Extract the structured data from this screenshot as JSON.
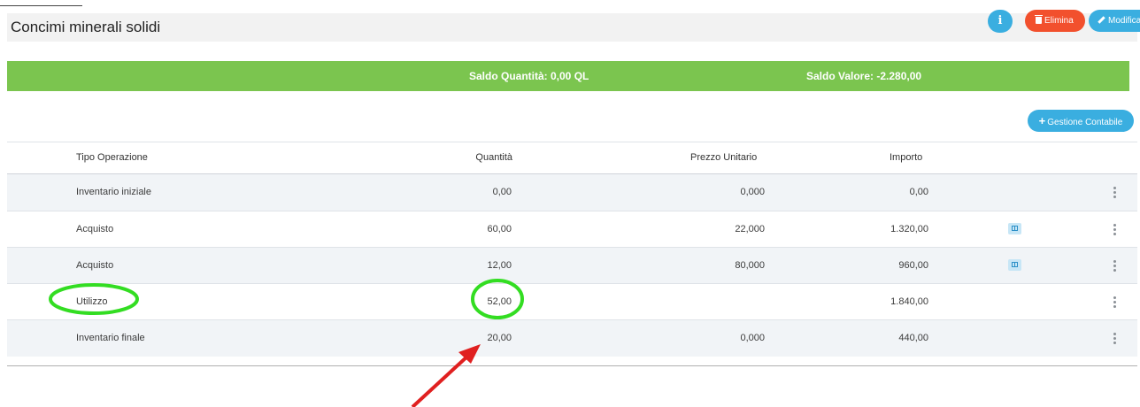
{
  "header": {
    "title": "Concimi minerali solidi",
    "info_label": "i",
    "delete_label": "Elimina",
    "edit_label": "Modifica"
  },
  "saldo": {
    "quantita": "Saldo Quantità: 0,00 QL",
    "valore": "Saldo Valore: -2.280,00"
  },
  "gestione_label": "Gestione Contabile",
  "table": {
    "headers": {
      "tipo": "Tipo Operazione",
      "quantita": "Quantità",
      "prezzo": "Prezzo Unitario",
      "importo": "Importo"
    },
    "rows": [
      {
        "tipo": "Inventario iniziale",
        "quantita": "0,00",
        "prezzo": "0,000",
        "importo": "0,00",
        "doc": false
      },
      {
        "tipo": "Acquisto",
        "quantita": "60,00",
        "prezzo": "22,000",
        "importo": "1.320,00",
        "doc": true
      },
      {
        "tipo": "Acquisto",
        "quantita": "12,00",
        "prezzo": "80,000",
        "importo": "960,00",
        "doc": true
      },
      {
        "tipo": "Utilizzo",
        "quantita": "52,00",
        "prezzo": "",
        "importo": "1.840,00",
        "doc": false
      },
      {
        "tipo": "Inventario finale",
        "quantita": "20,00",
        "prezzo": "0,000",
        "importo": "440,00",
        "doc": false
      }
    ]
  },
  "icons": {
    "info": "info-icon",
    "delete": "trash-icon",
    "edit": "pencil-icon",
    "add": "plus-icon",
    "document": "document-icon",
    "menu": "kebab-menu-icon"
  },
  "colors": {
    "accent_blue": "#3aaee0",
    "danger_red": "#f2502d",
    "saldo_green": "#7bc54f",
    "annotation_green": "#33dd22",
    "annotation_red": "#e02020"
  }
}
